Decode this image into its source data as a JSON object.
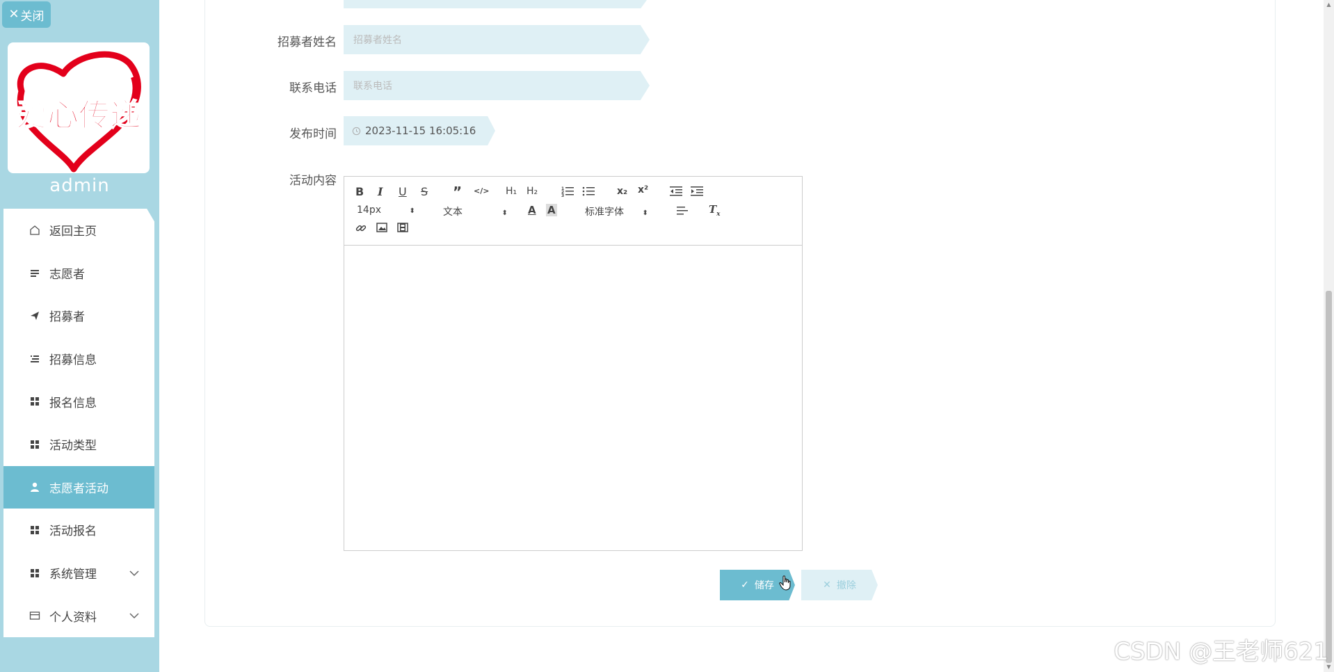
{
  "sidebar": {
    "close_label": "关闭",
    "logo_text": "爱心传递",
    "username": "admin",
    "menu": [
      {
        "label": "返回主页",
        "icon": "home-icon"
      },
      {
        "label": "志愿者",
        "icon": "lines-icon"
      },
      {
        "label": "招募者",
        "icon": "send-icon"
      },
      {
        "label": "招募信息",
        "icon": "list-icon"
      },
      {
        "label": "报名信息",
        "icon": "grid-icon"
      },
      {
        "label": "活动类型",
        "icon": "grid-icon"
      },
      {
        "label": "志愿者活动",
        "icon": "user-icon",
        "active": true
      },
      {
        "label": "活动报名",
        "icon": "grid-icon"
      },
      {
        "label": "系统管理",
        "icon": "grid-icon",
        "expandable": true
      },
      {
        "label": "个人资料",
        "icon": "card-icon",
        "expandable": true
      }
    ]
  },
  "form": {
    "recruiter_name_label": "招募者姓名",
    "recruiter_name_placeholder": "招募者姓名",
    "phone_label": "联系电话",
    "phone_placeholder": "联系电话",
    "publish_time_label": "发布时间",
    "publish_time_value": "2023-11-15 16:05:16",
    "content_label": "活动内容"
  },
  "editor": {
    "font_size": "14px",
    "text_format": "文本",
    "font_family": "标准字体"
  },
  "buttons": {
    "save_label": "储存",
    "reset_label": "撤除"
  },
  "watermark": "CSDN @王老师621",
  "colors": {
    "sidebar_bg": "#a9d7e3",
    "accent": "#6cbcd0",
    "field_bg": "#dff0f5"
  }
}
